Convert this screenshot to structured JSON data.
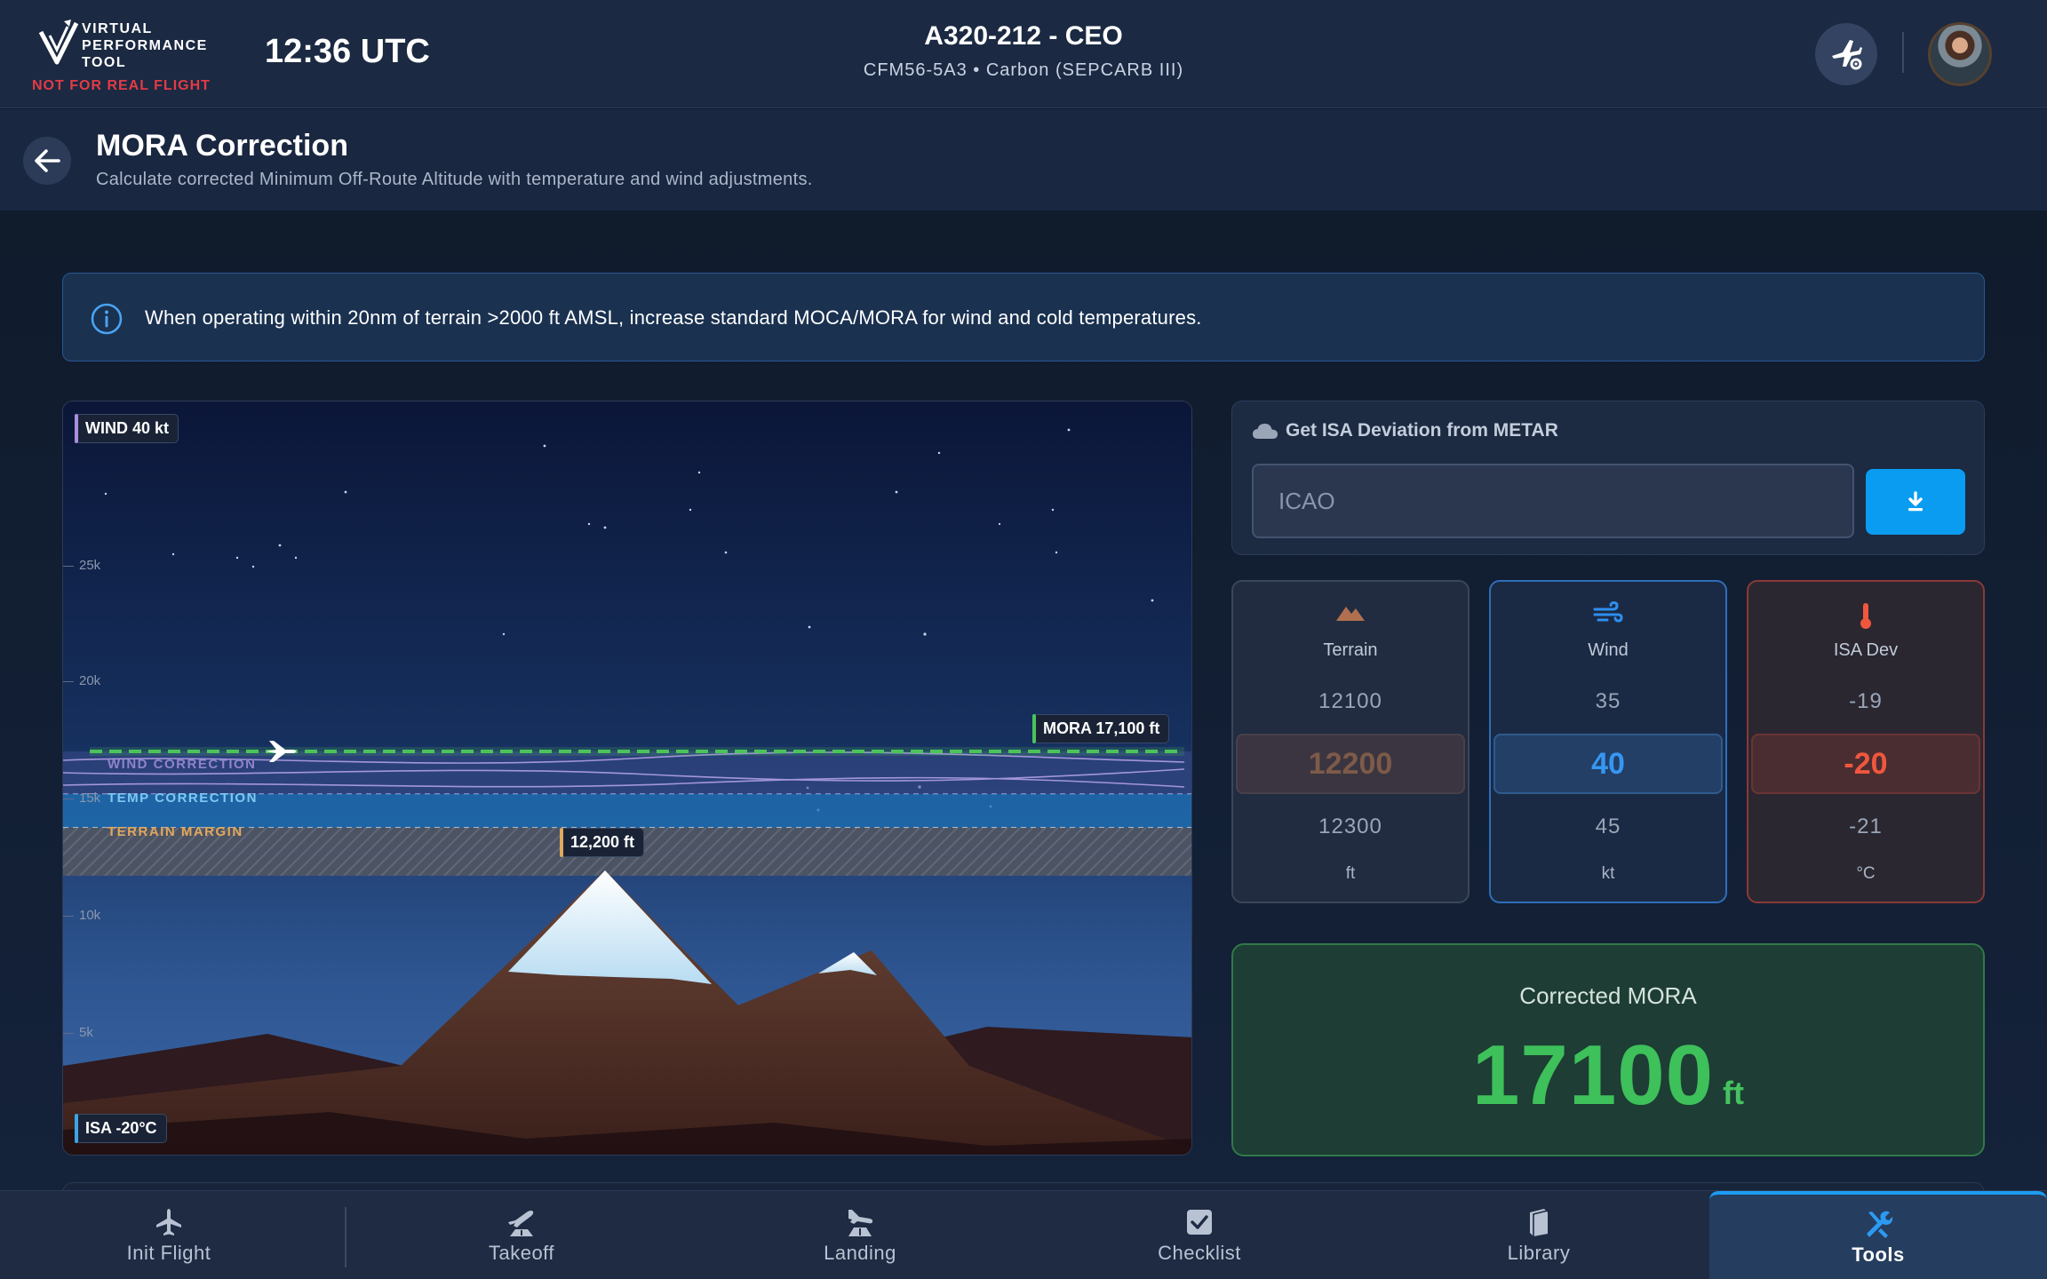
{
  "header": {
    "logo_text": "VIRTUAL\nPERFORMANCE\nTOOL",
    "logo_warning": "NOT FOR REAL FLIGHT",
    "clock": "12:36 UTC",
    "aircraft_title": "A320-212 - CEO",
    "aircraft_subtitle": "CFM56-5A3  •  Carbon (SEPCARB III)",
    "settings_icon": "airplane-gear-icon",
    "avatar_icon": "user-avatar"
  },
  "page": {
    "title": "MORA Correction",
    "subtitle": "Calculate corrected Minimum Off-Route Altitude with temperature and wind adjustments.",
    "back_icon": "arrow-left-icon"
  },
  "info": {
    "icon": "info-circle-icon",
    "text": "When operating within 20nm of terrain >2000 ft AMSL, increase standard MOCA/MORA for wind and cold temperatures."
  },
  "visualization": {
    "wind_chip": "WIND  40 kt",
    "isa_chip": "ISA  -20°C",
    "mora_chip": "MORA  17,100 ft",
    "terrain_chip": "12,200 ft",
    "wind_correction_label": "WIND CORRECTION",
    "temp_correction_label": "TEMP CORRECTION",
    "terrain_margin_label": "TERRAIN MARGIN",
    "altitude_ticks": [
      "25k",
      "20k",
      "15k",
      "10k",
      "5k"
    ],
    "colors": {
      "mora": "#4cc35a",
      "wind": "#a98fe0",
      "temp": "#3ea4e6",
      "terrain_margin": "#d4a05a"
    }
  },
  "metar": {
    "title": "Get ISA Deviation from METAR",
    "icon": "cloud-icon",
    "input_placeholder": "ICAO",
    "input_value": "",
    "button_icon": "download-icon"
  },
  "pickers": [
    {
      "label": "Terrain",
      "icon": "mountain-icon",
      "above": "12100",
      "selected": "12200",
      "below": "12300",
      "unit": "ft",
      "color": "#b07050"
    },
    {
      "label": "Wind",
      "icon": "wind-icon",
      "above": "35",
      "selected": "40",
      "below": "45",
      "unit": "kt",
      "color": "#2d8ff0"
    },
    {
      "label": "ISA Dev",
      "icon": "thermometer-icon",
      "above": "-19",
      "selected": "-20",
      "below": "-21",
      "unit": "°C",
      "color": "#f0573d"
    }
  ],
  "result": {
    "title": "Corrected MORA",
    "value": "17100",
    "unit": "ft"
  },
  "nav": [
    {
      "label": "Init Flight",
      "icon": "airplane-icon",
      "active": false
    },
    {
      "label": "Takeoff",
      "icon": "takeoff-icon",
      "active": false
    },
    {
      "label": "Landing",
      "icon": "landing-icon",
      "active": false
    },
    {
      "label": "Checklist",
      "icon": "checkbox-icon",
      "active": false
    },
    {
      "label": "Library",
      "icon": "library-icon",
      "active": false
    },
    {
      "label": "Tools",
      "icon": "tools-icon",
      "active": true
    }
  ]
}
